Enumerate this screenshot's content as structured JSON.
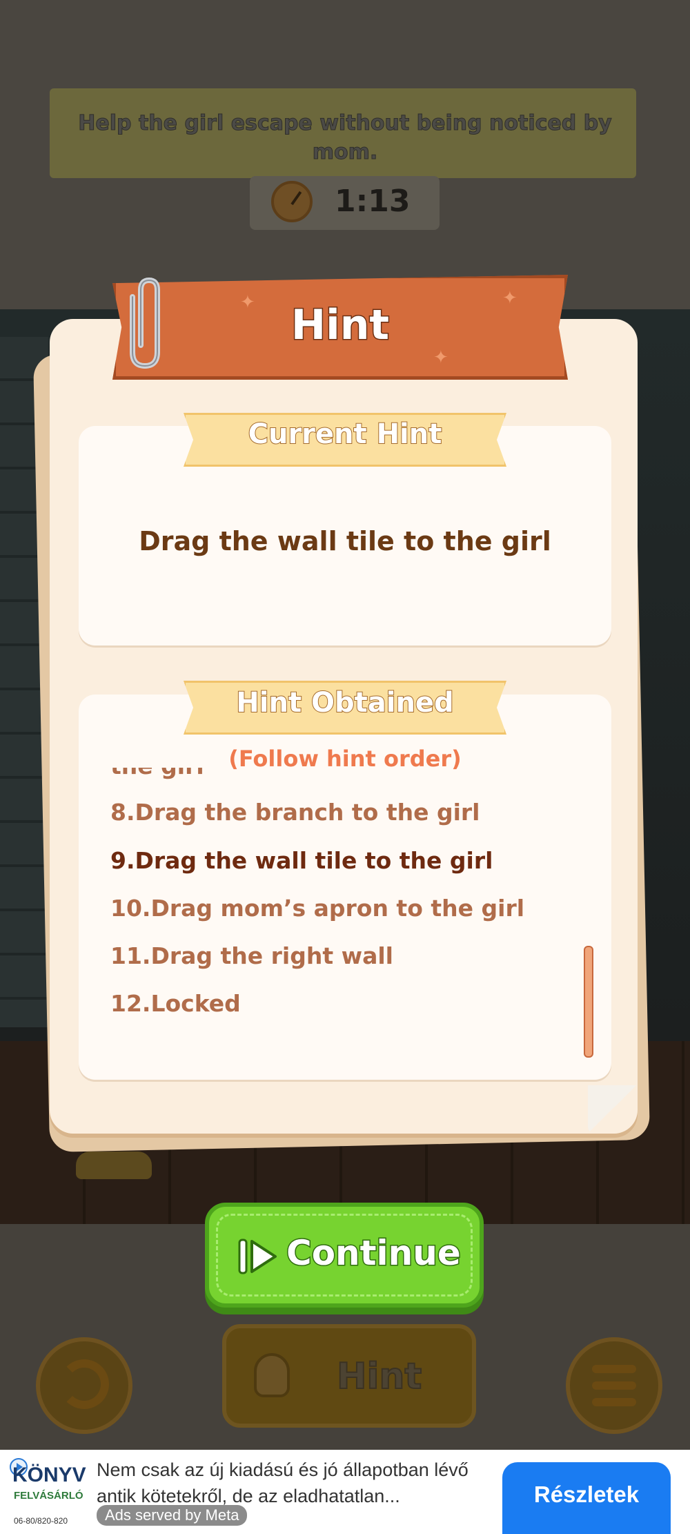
{
  "level": {
    "task": "Help the girl escape without being noticed by mom.",
    "timer": "1:13"
  },
  "dialog": {
    "title": "Hint",
    "current_hint_heading": "Current Hint",
    "current_hint": "Drag the wall tile to the girl",
    "obtained_heading": "Hint Obtained",
    "follow_order": "(Follow hint order)",
    "obtained_items": [
      "the girl",
      "8.Drag the branch to the girl",
      "9.Drag the wall tile to the girl",
      "10.Drag mom’s apron to the girl",
      "11.Drag the right wall",
      "12.Locked"
    ],
    "current_item_index": 2,
    "continue_label": "Continue"
  },
  "toolbar": {
    "hint_label": "Hint"
  },
  "ad": {
    "logo_line1": "KÖNYV",
    "logo_line2": "FELVÁSÁRLÓ",
    "logo_line3": "06-80/820-820",
    "text": "Nem csak az új kiadású és jó állapotban lévő antik kötetekről, de az eladhatatlan...",
    "served_by": "Ads served by Meta",
    "cta": "Részletek"
  },
  "colors": {
    "hint_banner": "#d46c3c",
    "continue_green": "#77d330",
    "ad_cta_blue": "#1a7cf2"
  }
}
